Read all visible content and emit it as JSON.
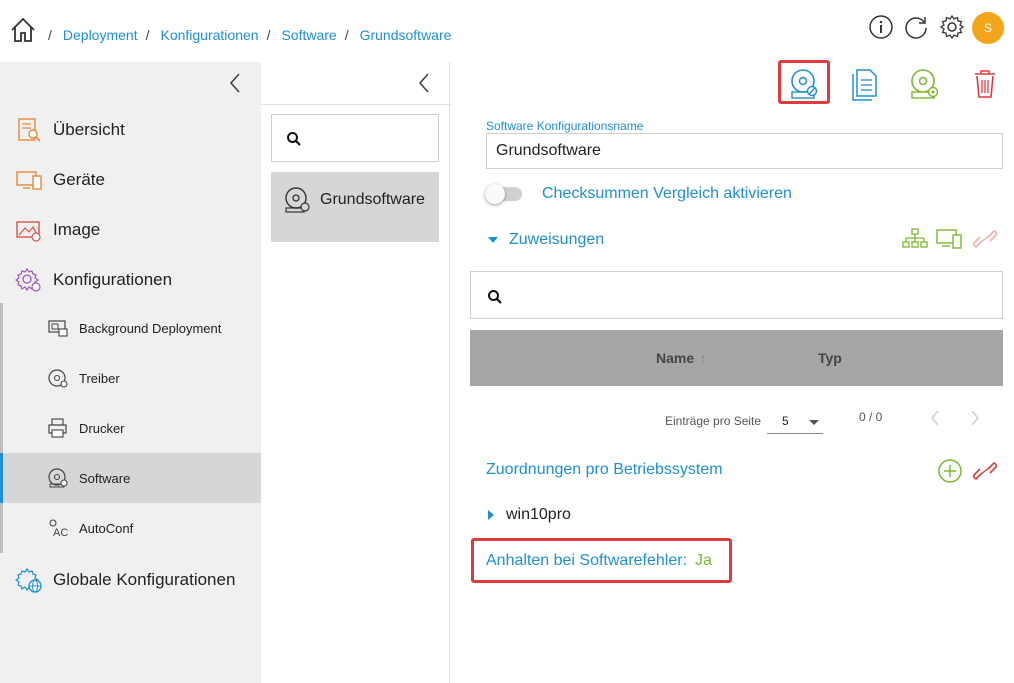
{
  "breadcrumb": {
    "separator": "/",
    "items": [
      "Deployment",
      "Konfigurationen",
      "Software",
      "Grundsoftware"
    ]
  },
  "header": {
    "info_icon": "info-icon",
    "refresh_icon": "refresh-icon",
    "settings_icon": "gear-icon",
    "avatar_initial": "S"
  },
  "sidebar": {
    "items": [
      {
        "label": "Übersicht",
        "icon": "overview-icon"
      },
      {
        "label": "Geräte",
        "icon": "devices-icon"
      },
      {
        "label": "Image",
        "icon": "image-icon"
      },
      {
        "label": "Konfigurationen",
        "icon": "configurations-icon"
      },
      {
        "label": "Background Deployment",
        "icon": "background-deployment-icon"
      },
      {
        "label": "Treiber",
        "icon": "driver-icon"
      },
      {
        "label": "Drucker",
        "icon": "printer-icon"
      },
      {
        "label": "Software",
        "icon": "software-disc-icon"
      },
      {
        "label": "AutoConf",
        "icon": "autoconf-icon"
      },
      {
        "label": "Globale Konfigurationen",
        "icon": "global-configurations-icon"
      }
    ],
    "active": "Software"
  },
  "middle": {
    "search_placeholder": "",
    "list": [
      {
        "label": "Grundsoftware"
      }
    ]
  },
  "toolbar": {
    "buttons": [
      "software-settings-icon",
      "document-copy-icon",
      "software-deploy-icon",
      "trash-icon"
    ]
  },
  "form": {
    "name_label": "Software Konfigurationsname",
    "name_value": "Grundsoftware",
    "checksum_label": "Checksummen Vergleich aktivieren",
    "checksum_enabled": false,
    "assignments_label": "Zuweisungen"
  },
  "table": {
    "search_placeholder": "",
    "columns": [
      "Name",
      "Typ"
    ],
    "sort_indicator": "↑",
    "rows": [],
    "pager": {
      "per_page_label": "Einträge pro Seite",
      "per_page_value": "5",
      "count": "0 / 0"
    }
  },
  "os_section": {
    "heading": "Zuordnungen pro Betriebssystem",
    "items": [
      "win10pro"
    ]
  },
  "halt": {
    "label": "Anhalten bei Softwarefehler:",
    "value": "Ja"
  },
  "colors": {
    "accent": "#1e8fd6",
    "green": "#7cb82f",
    "red": "#e03b3b",
    "avatar": "#f2a51a"
  }
}
